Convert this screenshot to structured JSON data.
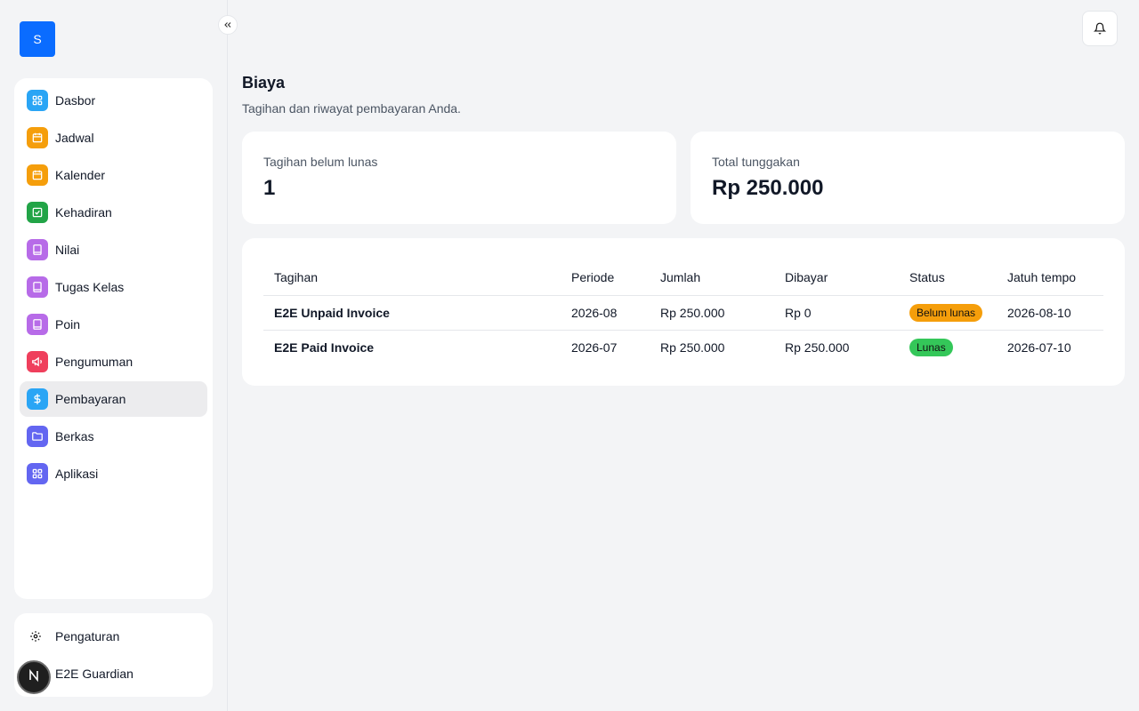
{
  "app": {
    "logo_letter": "S"
  },
  "sidebar": {
    "items": [
      {
        "label": "Dasbor",
        "icon": "grid-icon",
        "color": "#2aa5f5"
      },
      {
        "label": "Jadwal",
        "icon": "calendar-icon",
        "color": "#f59e0b"
      },
      {
        "label": "Kalender",
        "icon": "calendar-icon",
        "color": "#f59e0b"
      },
      {
        "label": "Kehadiran",
        "icon": "check-square-icon",
        "color": "#22a447"
      },
      {
        "label": "Nilai",
        "icon": "book-icon",
        "color": "#b76be8"
      },
      {
        "label": "Tugas Kelas",
        "icon": "book-icon",
        "color": "#b76be8"
      },
      {
        "label": "Poin",
        "icon": "book-icon",
        "color": "#b76be8"
      },
      {
        "label": "Pengumuman",
        "icon": "megaphone-icon",
        "color": "#ef3f5c"
      },
      {
        "label": "Pembayaran",
        "icon": "dollar-icon",
        "color": "#2aa5f5"
      },
      {
        "label": "Berkas",
        "icon": "folder-icon",
        "color": "#6366f1"
      },
      {
        "label": "Aplikasi",
        "icon": "apps-icon",
        "color": "#6366f1"
      }
    ],
    "active_index": 8,
    "bottom": {
      "settings_label": "Pengaturan",
      "user_label": "E2E Guardian"
    }
  },
  "page": {
    "title": "Biaya",
    "subtitle": "Tagihan dan riwayat pembayaran Anda."
  },
  "stats": {
    "unpaid_label": "Tagihan belum lunas",
    "unpaid_value": "1",
    "total_label": "Total tunggakan",
    "total_value": "Rp 250.000"
  },
  "table": {
    "headers": [
      "Tagihan",
      "Periode",
      "Jumlah",
      "Dibayar",
      "Status",
      "Jatuh tempo"
    ],
    "rows": [
      {
        "bill": "E2E Unpaid Invoice",
        "period": "2026-08",
        "amount": "Rp 250.000",
        "paid": "Rp 0",
        "status": "Belum lunas",
        "status_color": "#f59e0b",
        "due": "2026-08-10"
      },
      {
        "bill": "E2E Paid Invoice",
        "period": "2026-07",
        "amount": "Rp 250.000",
        "paid": "Rp 250.000",
        "status": "Lunas",
        "status_color": "#34c759",
        "due": "2026-07-10"
      }
    ]
  }
}
